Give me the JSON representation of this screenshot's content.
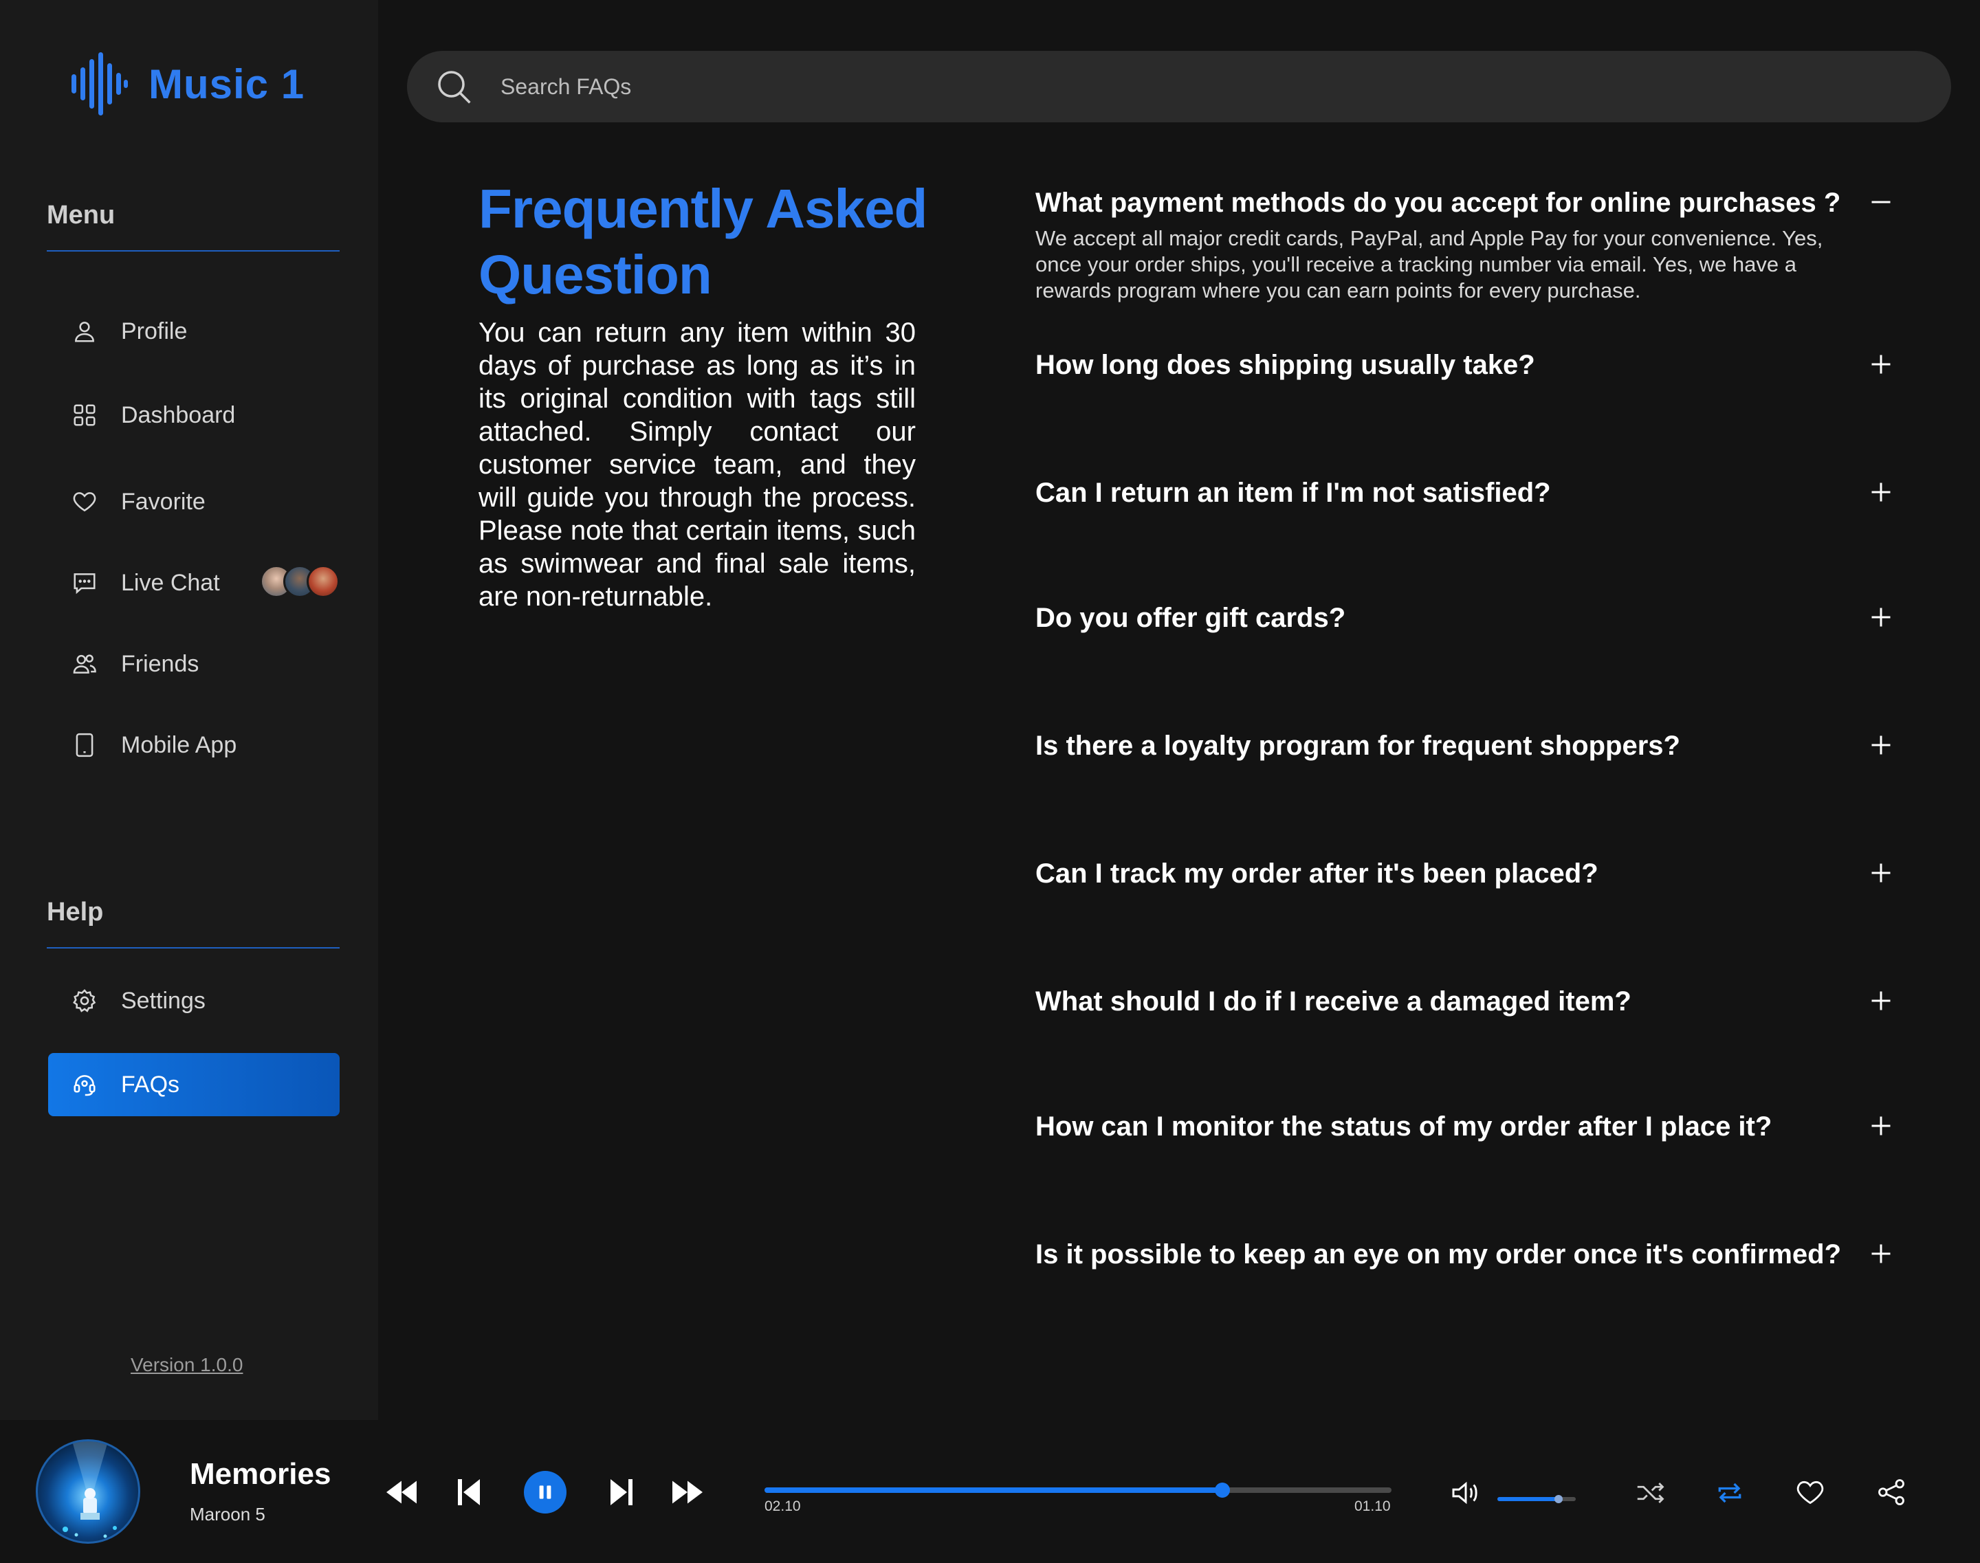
{
  "app": {
    "name": "Music 1",
    "accent_color": "#2f7cf0",
    "version_label": "Version 1.0.0"
  },
  "sidebar": {
    "menu_title": "Menu",
    "help_title": "Help",
    "menu_items": [
      {
        "label": "Profile",
        "icon": "user-icon"
      },
      {
        "label": "Dashboard",
        "icon": "grid-icon"
      },
      {
        "label": "Favorite",
        "icon": "heart-icon"
      },
      {
        "label": "Live Chat",
        "icon": "chat-icon"
      },
      {
        "label": "Friends",
        "icon": "users-icon"
      },
      {
        "label": "Mobile App",
        "icon": "phone-icon"
      }
    ],
    "help_items": [
      {
        "label": "Settings",
        "icon": "gear-icon"
      },
      {
        "label": "FAQs",
        "icon": "headset-icon",
        "active": true
      }
    ]
  },
  "search": {
    "placeholder": "Search FAQs",
    "value": ""
  },
  "faq": {
    "title": "Frequently Asked Question",
    "intro": "You can return any item within 30 days of purchase as long as it’s in its original condition with tags still attached. Simply contact our customer service team, and they will guide you through the process. Please note that certain items, such as swimwear and final sale items, are non-returnable.",
    "items": [
      {
        "question": "What payment methods do you accept for online purchases ?",
        "answer": "We accept all major credit cards, PayPal, and Apple Pay for your convenience. Yes, once your order ships, you'll receive a tracking number via email. Yes, we have a rewards program where you can earn points for every purchase.",
        "expanded": true
      },
      {
        "question": "How long does shipping usually take?",
        "expanded": false
      },
      {
        "question": "Can I return an item if I'm not satisfied?",
        "expanded": false
      },
      {
        "question": "Do you offer gift cards?",
        "expanded": false
      },
      {
        "question": "Is there a loyalty program for frequent shoppers?",
        "expanded": false
      },
      {
        "question": "Can I track my order after it's been placed?",
        "expanded": false
      },
      {
        "question": "What should I do if I receive a damaged item?",
        "expanded": false
      },
      {
        "question": "How can I monitor the status of my order after I place it?",
        "expanded": false
      },
      {
        "question": "Is it possible to keep an eye on my order once it's confirmed?",
        "expanded": false
      }
    ]
  },
  "player": {
    "title": "Memories",
    "artist": "Maroon 5",
    "elapsed": "02.10",
    "remaining": "01.10",
    "progress": 0.73,
    "volume": 0.78,
    "repeat_active": true,
    "state": "playing"
  }
}
